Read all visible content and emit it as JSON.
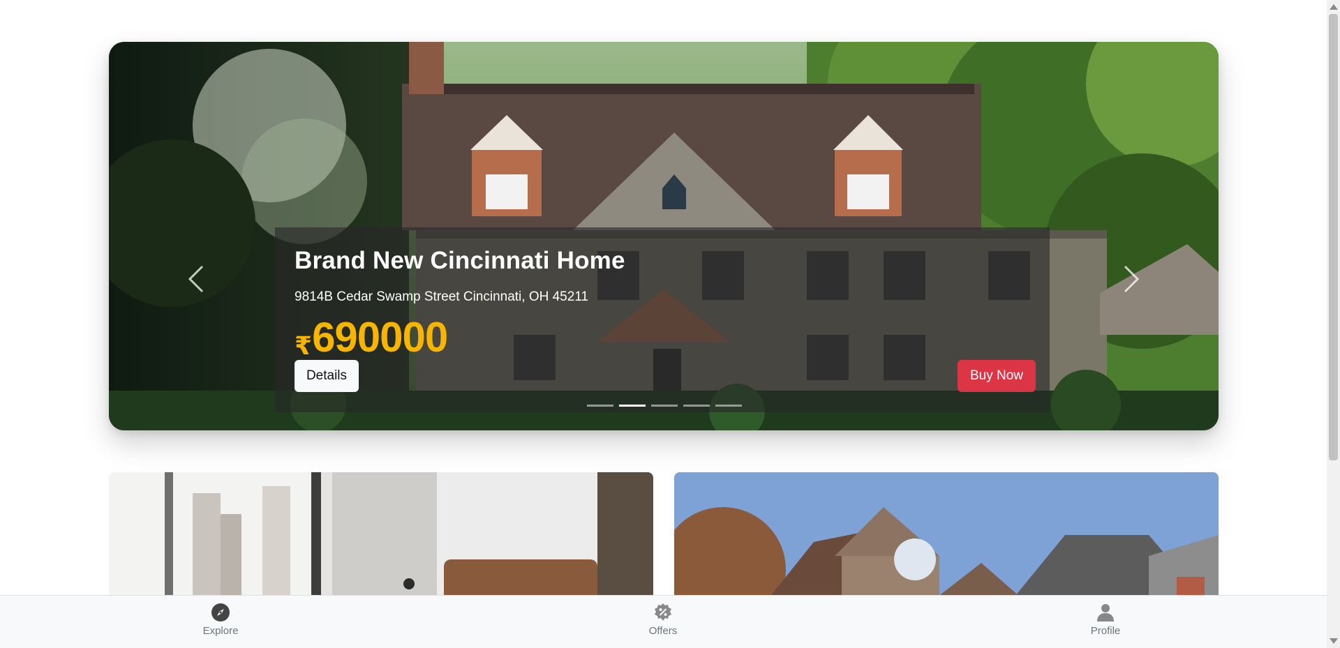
{
  "hero": {
    "title": "Brand New Cincinnati Home",
    "address": "9814B Cedar Swamp Street Cincinnati, OH 45211",
    "currency": "₹",
    "price": "690000",
    "details_label": "Details",
    "buy_label": "Buy Now",
    "slide_count": 5,
    "active_slide": 2
  },
  "colors": {
    "price": "#f7b500",
    "buy_button": "#dc3545",
    "details_button": "#f8f9fa",
    "nav_text": "#6c757d"
  },
  "bottom_nav": {
    "items": [
      {
        "label": "Explore",
        "icon": "compass-icon"
      },
      {
        "label": "Offers",
        "icon": "discount-badge-icon"
      },
      {
        "label": "Profile",
        "icon": "person-icon"
      }
    ]
  }
}
